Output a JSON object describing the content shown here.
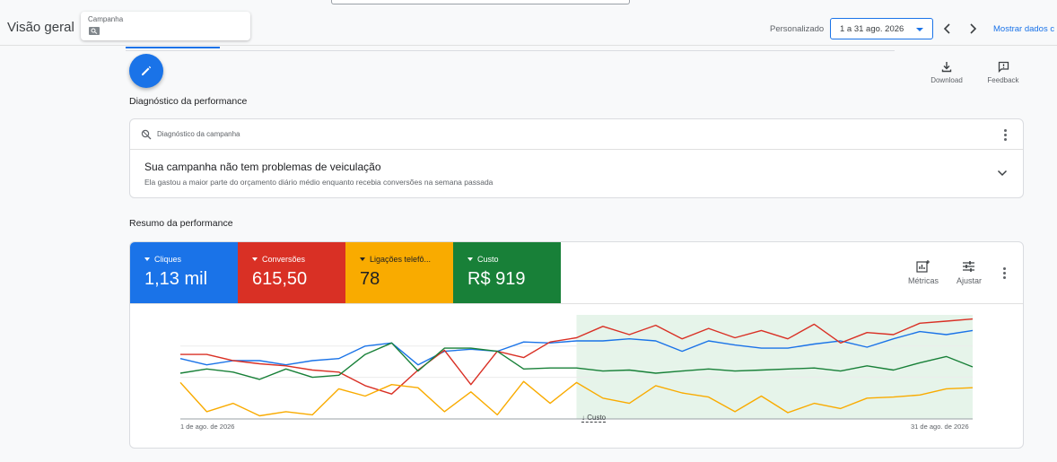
{
  "header": {
    "title": "Visão geral",
    "campaign_label": "Campanha",
    "date_range_label": "Personalizado",
    "date_range_value": "1 a 31 ago. 2026",
    "show_data_link": "Mostrar dados c"
  },
  "actions": {
    "download": "Download",
    "feedback": "Feedback"
  },
  "diagnostics": {
    "section_title": "Diagnóstico da performance",
    "card_header": "Diagnóstico da campanha",
    "main_text": "Sua campanha não tem problemas de veiculação",
    "sub_text": "Ela gastou a maior parte do orçamento diário médio enquanto recebia conversões na semana passada"
  },
  "performance": {
    "section_title": "Resumo da performance",
    "tiles": [
      {
        "name": "Cliques",
        "value": "1,13 mil",
        "color": "#1a73e8"
      },
      {
        "name": "Conversões",
        "value": "615,50",
        "color": "#d93025"
      },
      {
        "name": "Ligações telefô...",
        "value": "78",
        "color": "#f9ab00"
      },
      {
        "name": "Custo",
        "value": "R$ 919",
        "color": "#188038"
      }
    ],
    "toolbar": {
      "metrics": "Métricas",
      "adjust": "Ajustar"
    },
    "x_start": "1 de ago. de 2026",
    "x_end": "31 de ago. de 2026",
    "cost_marker": "Custo"
  },
  "chart_data": {
    "type": "line",
    "x": [
      1,
      2,
      3,
      4,
      5,
      6,
      7,
      8,
      9,
      10,
      11,
      12,
      13,
      14,
      15,
      16,
      17,
      18,
      19,
      20,
      21,
      22,
      23,
      24,
      25,
      26,
      27,
      28,
      29,
      30,
      31
    ],
    "highlight_from_day": 16,
    "series": [
      {
        "name": "Cliques",
        "color": "#1a73e8",
        "values": [
          58,
          52,
          56,
          56,
          52,
          56,
          58,
          70,
          73,
          52,
          65,
          67,
          65,
          74,
          73,
          75,
          75,
          77,
          75,
          65,
          75,
          71,
          68,
          68,
          72,
          75,
          69,
          77,
          84,
          81,
          85
        ]
      },
      {
        "name": "Conversões",
        "color": "#d93025",
        "values": [
          62,
          62,
          56,
          53,
          51,
          47,
          45,
          32,
          24,
          47,
          66,
          33,
          65,
          59,
          74,
          78,
          89,
          81,
          90,
          77,
          87,
          78,
          85,
          77,
          91,
          73,
          83,
          81,
          92,
          94,
          96
        ]
      },
      {
        "name": "Ligações telefônicas",
        "color": "#f9ab00",
        "values": [
          35,
          7,
          15,
          3,
          7,
          4,
          29,
          22,
          33,
          30,
          7,
          26,
          4,
          36,
          15,
          35,
          20,
          15,
          32,
          25,
          21,
          7,
          22,
          6,
          15,
          10,
          20,
          21,
          23,
          29,
          30
        ]
      },
      {
        "name": "Custo",
        "color": "#188038",
        "values": [
          44,
          48,
          45,
          38,
          48,
          40,
          42,
          62,
          73,
          46,
          68,
          68,
          65,
          48,
          49,
          49,
          46,
          47,
          44,
          46,
          48,
          46,
          47,
          48,
          49,
          46,
          51,
          47,
          54,
          60,
          50
        ]
      }
    ]
  }
}
